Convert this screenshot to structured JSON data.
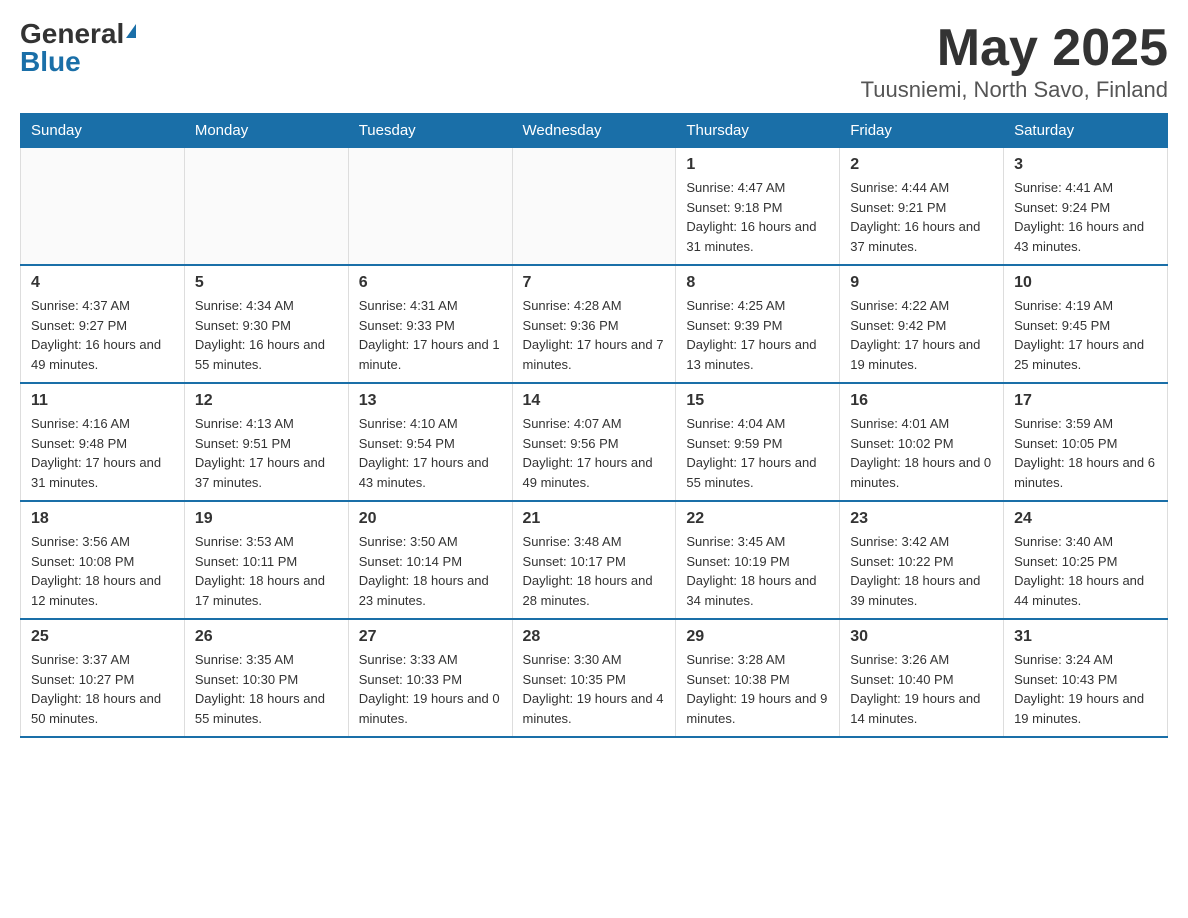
{
  "logo": {
    "general": "General",
    "blue": "Blue"
  },
  "title": "May 2025",
  "subtitle": "Tuusniemi, North Savo, Finland",
  "header_days": [
    "Sunday",
    "Monday",
    "Tuesday",
    "Wednesday",
    "Thursday",
    "Friday",
    "Saturday"
  ],
  "weeks": [
    [
      {
        "day": "",
        "info": ""
      },
      {
        "day": "",
        "info": ""
      },
      {
        "day": "",
        "info": ""
      },
      {
        "day": "",
        "info": ""
      },
      {
        "day": "1",
        "info": "Sunrise: 4:47 AM\nSunset: 9:18 PM\nDaylight: 16 hours and 31 minutes."
      },
      {
        "day": "2",
        "info": "Sunrise: 4:44 AM\nSunset: 9:21 PM\nDaylight: 16 hours and 37 minutes."
      },
      {
        "day": "3",
        "info": "Sunrise: 4:41 AM\nSunset: 9:24 PM\nDaylight: 16 hours and 43 minutes."
      }
    ],
    [
      {
        "day": "4",
        "info": "Sunrise: 4:37 AM\nSunset: 9:27 PM\nDaylight: 16 hours and 49 minutes."
      },
      {
        "day": "5",
        "info": "Sunrise: 4:34 AM\nSunset: 9:30 PM\nDaylight: 16 hours and 55 minutes."
      },
      {
        "day": "6",
        "info": "Sunrise: 4:31 AM\nSunset: 9:33 PM\nDaylight: 17 hours and 1 minute."
      },
      {
        "day": "7",
        "info": "Sunrise: 4:28 AM\nSunset: 9:36 PM\nDaylight: 17 hours and 7 minutes."
      },
      {
        "day": "8",
        "info": "Sunrise: 4:25 AM\nSunset: 9:39 PM\nDaylight: 17 hours and 13 minutes."
      },
      {
        "day": "9",
        "info": "Sunrise: 4:22 AM\nSunset: 9:42 PM\nDaylight: 17 hours and 19 minutes."
      },
      {
        "day": "10",
        "info": "Sunrise: 4:19 AM\nSunset: 9:45 PM\nDaylight: 17 hours and 25 minutes."
      }
    ],
    [
      {
        "day": "11",
        "info": "Sunrise: 4:16 AM\nSunset: 9:48 PM\nDaylight: 17 hours and 31 minutes."
      },
      {
        "day": "12",
        "info": "Sunrise: 4:13 AM\nSunset: 9:51 PM\nDaylight: 17 hours and 37 minutes."
      },
      {
        "day": "13",
        "info": "Sunrise: 4:10 AM\nSunset: 9:54 PM\nDaylight: 17 hours and 43 minutes."
      },
      {
        "day": "14",
        "info": "Sunrise: 4:07 AM\nSunset: 9:56 PM\nDaylight: 17 hours and 49 minutes."
      },
      {
        "day": "15",
        "info": "Sunrise: 4:04 AM\nSunset: 9:59 PM\nDaylight: 17 hours and 55 minutes."
      },
      {
        "day": "16",
        "info": "Sunrise: 4:01 AM\nSunset: 10:02 PM\nDaylight: 18 hours and 0 minutes."
      },
      {
        "day": "17",
        "info": "Sunrise: 3:59 AM\nSunset: 10:05 PM\nDaylight: 18 hours and 6 minutes."
      }
    ],
    [
      {
        "day": "18",
        "info": "Sunrise: 3:56 AM\nSunset: 10:08 PM\nDaylight: 18 hours and 12 minutes."
      },
      {
        "day": "19",
        "info": "Sunrise: 3:53 AM\nSunset: 10:11 PM\nDaylight: 18 hours and 17 minutes."
      },
      {
        "day": "20",
        "info": "Sunrise: 3:50 AM\nSunset: 10:14 PM\nDaylight: 18 hours and 23 minutes."
      },
      {
        "day": "21",
        "info": "Sunrise: 3:48 AM\nSunset: 10:17 PM\nDaylight: 18 hours and 28 minutes."
      },
      {
        "day": "22",
        "info": "Sunrise: 3:45 AM\nSunset: 10:19 PM\nDaylight: 18 hours and 34 minutes."
      },
      {
        "day": "23",
        "info": "Sunrise: 3:42 AM\nSunset: 10:22 PM\nDaylight: 18 hours and 39 minutes."
      },
      {
        "day": "24",
        "info": "Sunrise: 3:40 AM\nSunset: 10:25 PM\nDaylight: 18 hours and 44 minutes."
      }
    ],
    [
      {
        "day": "25",
        "info": "Sunrise: 3:37 AM\nSunset: 10:27 PM\nDaylight: 18 hours and 50 minutes."
      },
      {
        "day": "26",
        "info": "Sunrise: 3:35 AM\nSunset: 10:30 PM\nDaylight: 18 hours and 55 minutes."
      },
      {
        "day": "27",
        "info": "Sunrise: 3:33 AM\nSunset: 10:33 PM\nDaylight: 19 hours and 0 minutes."
      },
      {
        "day": "28",
        "info": "Sunrise: 3:30 AM\nSunset: 10:35 PM\nDaylight: 19 hours and 4 minutes."
      },
      {
        "day": "29",
        "info": "Sunrise: 3:28 AM\nSunset: 10:38 PM\nDaylight: 19 hours and 9 minutes."
      },
      {
        "day": "30",
        "info": "Sunrise: 3:26 AM\nSunset: 10:40 PM\nDaylight: 19 hours and 14 minutes."
      },
      {
        "day": "31",
        "info": "Sunrise: 3:24 AM\nSunset: 10:43 PM\nDaylight: 19 hours and 19 minutes."
      }
    ]
  ]
}
